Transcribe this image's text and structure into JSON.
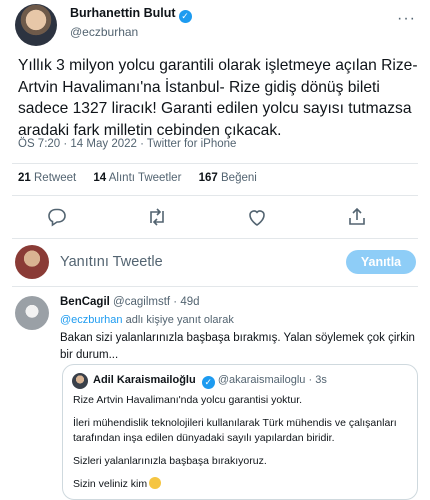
{
  "tweet": {
    "author_name": "Burhanettin Bulut",
    "author_handle": "@eczburhan",
    "text": "Yıllık 3 milyon yolcu garantili olarak işletmeye açılan Rize-Artvin Havalimanı'na İstanbul- Rize gidiş dönüş bileti sadece 1327 liracık! Garanti edilen yolcu sayısı tutmazsa aradaki fark milletin cebinden çıkacak.",
    "meta": "ÖS 7:20 · 14 May 2022 · Twitter for iPhone",
    "stats": [
      {
        "count": "21",
        "label": "Retweet"
      },
      {
        "count": "14",
        "label": "Alıntı Tweetler"
      },
      {
        "count": "167",
        "label": "Beğeni"
      }
    ],
    "actions": [
      "reply-icon",
      "retweet-icon",
      "like-icon",
      "share-icon"
    ]
  },
  "reply_box": {
    "placeholder": "Yanıtını Tweetle",
    "button_label": "Yanıtla"
  },
  "reply": {
    "author_name": "BenCagil",
    "author_handle": "@cagilmstf",
    "time": "49d",
    "replying_prefix": "",
    "replying_mention": "@eczburhan",
    "replying_suffix": " adlı kişiye yanıt olarak",
    "text": "Bakan sizi yalanlarınızla başbaşa bırakmış. Yalan söylemek çok çirkin bir durum..."
  },
  "quote": {
    "author_name": "Adil Karaismailoğlu",
    "author_handle": "@akaraismailoglu",
    "time": "3s",
    "p1": "Rize Artvin Havalimanı'nda yolcu garantisi yoktur.",
    "p2": "İleri mühendislik teknolojileri kullanılarak Türk mühendis ve çalışanları tarafından inşa edilen dünyadaki sayılı yapılardan biridir.",
    "p3": "Sizleri yalanlarınızla başbaşa bırakıyoruz.",
    "p4": "Sizin veliniz kim"
  },
  "colors": {
    "accent": "#1d9bf0",
    "accent_disabled": "#8ecdf7",
    "muted": "#536471",
    "text": "#0f1419"
  }
}
